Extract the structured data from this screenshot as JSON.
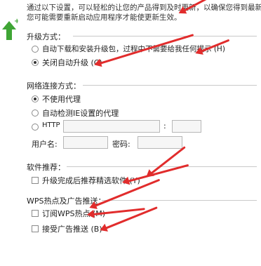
{
  "intro": {
    "line1": "通过以下设置，可以轻松的让您的产品得到及时更新，以确保您得到最新的服",
    "line2": "您可能需要重新启动应用程序才能使更新生效。"
  },
  "upgrade_method": {
    "title": "升级方式：",
    "options": [
      {
        "label": "自动下载和安装升级包，过程中不需要给我任何提示 (H)",
        "selected": false
      },
      {
        "label": "关闭自动升级 (C)",
        "selected": true
      }
    ]
  },
  "network": {
    "title": "网络连接方式：",
    "options": [
      {
        "label": "不使用代理",
        "selected": true
      },
      {
        "label": "自动检测IE设置的代理",
        "selected": false
      },
      {
        "label": "HTTP",
        "selected": false
      }
    ],
    "host_value": "",
    "port_separator": ":",
    "port_value": "",
    "username_label": "用户名:",
    "username_value": "",
    "password_label": "密码:",
    "password_value": ""
  },
  "software_recommend": {
    "title": "软件推荐：",
    "checkbox_label": "升级完成后推荐精选软件 (Y)",
    "checked": false
  },
  "wps_hotspot": {
    "title": "WPS热点及广告推送：",
    "items": [
      {
        "label": "订阅WPS热点 (M)",
        "checked": false
      },
      {
        "label": "接受广告推送 (B)",
        "checked": false
      }
    ]
  },
  "colors": {
    "accent_green": "#3fa535",
    "annotation_red": "#e12c2c"
  }
}
